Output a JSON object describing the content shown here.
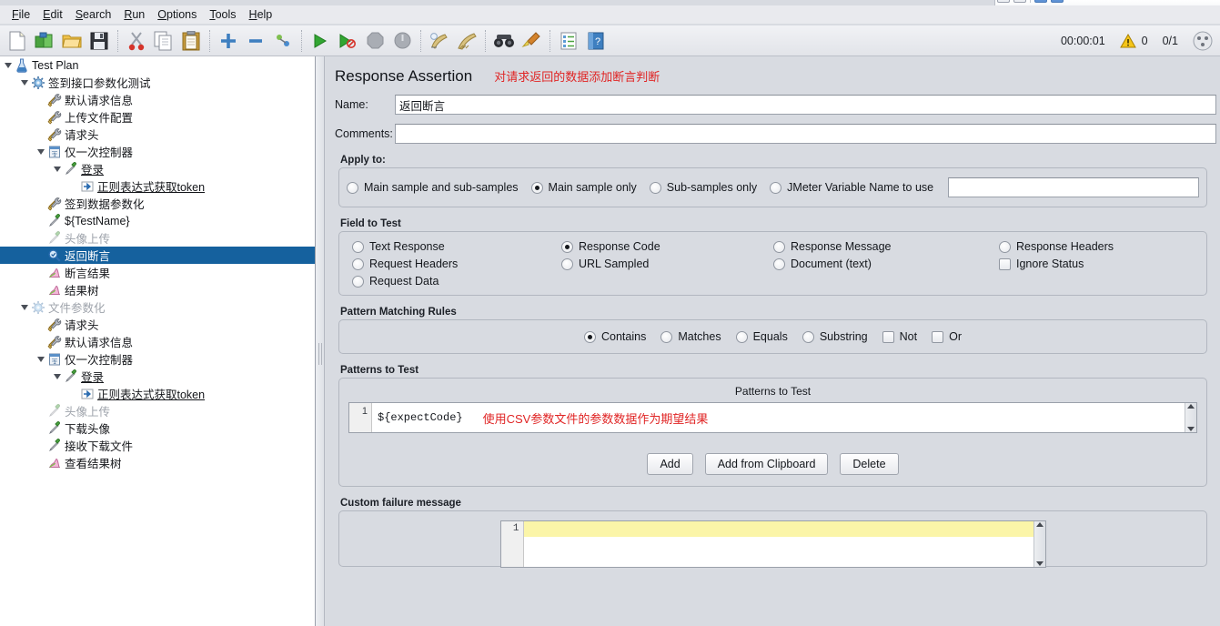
{
  "app": {
    "menus": [
      {
        "label": "File",
        "mnemonic": "F"
      },
      {
        "label": "Edit",
        "mnemonic": "E"
      },
      {
        "label": "Search",
        "mnemonic": "S"
      },
      {
        "label": "Run",
        "mnemonic": "R"
      },
      {
        "label": "Options",
        "mnemonic": "O"
      },
      {
        "label": "Tools",
        "mnemonic": "T"
      },
      {
        "label": "Help",
        "mnemonic": "H"
      }
    ],
    "toolbar": {
      "icons": [
        "new-file-icon",
        "templates-icon",
        "open-icon",
        "save-icon",
        "cut-icon",
        "copy-icon",
        "paste-icon",
        "expand-all-icon",
        "collapse-all-icon",
        "toggle-icon",
        "start-icon",
        "start-no-pauses-icon",
        "stop-icon",
        "shutdown-icon",
        "clear-icon",
        "clear-all-icon",
        "search-icon",
        "search-reset-icon",
        "function-helper-icon",
        "help-icon"
      ],
      "status": {
        "elapsed": "00:00:01",
        "warning_icon": "warning-triangle-icon",
        "warning_count": "0",
        "threads": "0/1",
        "threads_icon": "threads-icon"
      }
    }
  },
  "tree": {
    "nodes": [
      {
        "label": "Test Plan",
        "depth": 0,
        "icon": "test-plan-icon",
        "toggle": "open",
        "selected": false,
        "disabled": false,
        "underline": false
      },
      {
        "label": "签到接口参数化测试",
        "depth": 1,
        "icon": "thread-group-icon",
        "toggle": "open",
        "selected": false,
        "disabled": false,
        "underline": false
      },
      {
        "label": "默认请求信息",
        "depth": 2,
        "icon": "config-element-icon",
        "toggle": "none",
        "selected": false,
        "disabled": false,
        "underline": false
      },
      {
        "label": "上传文件配置",
        "depth": 2,
        "icon": "config-element-icon",
        "toggle": "none",
        "selected": false,
        "disabled": false,
        "underline": false
      },
      {
        "label": "请求头",
        "depth": 2,
        "icon": "config-element-icon",
        "toggle": "none",
        "selected": false,
        "disabled": false,
        "underline": false
      },
      {
        "label": "仅一次控制器",
        "depth": 2,
        "icon": "controller-icon",
        "toggle": "open",
        "selected": false,
        "disabled": false,
        "underline": false
      },
      {
        "label": "登录",
        "depth": 3,
        "icon": "http-sampler-icon",
        "toggle": "open",
        "selected": false,
        "disabled": false,
        "underline": true
      },
      {
        "label": "正则表达式获取token",
        "depth": 4,
        "icon": "post-processor-icon",
        "toggle": "none",
        "selected": false,
        "disabled": false,
        "underline": true
      },
      {
        "label": "签到数据参数化",
        "depth": 2,
        "icon": "config-element-icon",
        "toggle": "none",
        "selected": false,
        "disabled": false,
        "underline": false
      },
      {
        "label": "${TestName}",
        "depth": 2,
        "icon": "http-sampler-icon",
        "toggle": "none",
        "selected": false,
        "disabled": false,
        "underline": false
      },
      {
        "label": "头像上传",
        "depth": 2,
        "icon": "http-sampler-disabled-icon",
        "toggle": "none",
        "selected": false,
        "disabled": true,
        "underline": false
      },
      {
        "label": "返回断言",
        "depth": 2,
        "icon": "assertion-icon",
        "toggle": "none",
        "selected": true,
        "disabled": false,
        "underline": false
      },
      {
        "label": "断言结果",
        "depth": 2,
        "icon": "listener-icon",
        "toggle": "none",
        "selected": false,
        "disabled": false,
        "underline": false
      },
      {
        "label": "结果树",
        "depth": 2,
        "icon": "listener-icon",
        "toggle": "none",
        "selected": false,
        "disabled": false,
        "underline": false
      },
      {
        "label": "文件参数化",
        "depth": 1,
        "icon": "thread-group-disabled-icon",
        "toggle": "open",
        "selected": false,
        "disabled": true,
        "underline": false
      },
      {
        "label": "请求头",
        "depth": 2,
        "icon": "config-element-icon",
        "toggle": "none",
        "selected": false,
        "disabled": false,
        "underline": false
      },
      {
        "label": "默认请求信息",
        "depth": 2,
        "icon": "config-element-icon",
        "toggle": "none",
        "selected": false,
        "disabled": false,
        "underline": false
      },
      {
        "label": "仅一次控制器",
        "depth": 2,
        "icon": "controller-icon",
        "toggle": "open",
        "selected": false,
        "disabled": false,
        "underline": false
      },
      {
        "label": "登录",
        "depth": 3,
        "icon": "http-sampler-icon",
        "toggle": "open",
        "selected": false,
        "disabled": false,
        "underline": true
      },
      {
        "label": "正则表达式获取token",
        "depth": 4,
        "icon": "post-processor-icon",
        "toggle": "none",
        "selected": false,
        "disabled": false,
        "underline": true
      },
      {
        "label": "头像上传",
        "depth": 2,
        "icon": "http-sampler-disabled-icon",
        "toggle": "none",
        "selected": false,
        "disabled": true,
        "underline": false
      },
      {
        "label": "下载头像",
        "depth": 2,
        "icon": "http-sampler-icon",
        "toggle": "none",
        "selected": false,
        "disabled": false,
        "underline": false
      },
      {
        "label": "接收下载文件",
        "depth": 2,
        "icon": "http-sampler-icon",
        "toggle": "none",
        "selected": false,
        "disabled": false,
        "underline": false
      },
      {
        "label": "查看结果树",
        "depth": 2,
        "icon": "listener-icon",
        "toggle": "none",
        "selected": false,
        "disabled": false,
        "underline": false
      }
    ]
  },
  "panel": {
    "title": "Response Assertion",
    "title_note": "对请求返回的数据添加断言判断",
    "name_label": "Name:",
    "name_value": "返回断言",
    "comments_label": "Comments:",
    "comments_value": "",
    "apply_to": {
      "title": "Apply to:",
      "options": [
        {
          "label": "Main sample and sub-samples",
          "selected": false
        },
        {
          "label": "Main sample only",
          "selected": true
        },
        {
          "label": "Sub-samples only",
          "selected": false
        },
        {
          "label": "JMeter Variable Name to use",
          "selected": false
        }
      ],
      "variable_value": ""
    },
    "field_to_test": {
      "title": "Field to Test",
      "col1": [
        {
          "label": "Text Response",
          "type": "radio",
          "selected": false
        },
        {
          "label": "Request Headers",
          "type": "radio",
          "selected": false
        },
        {
          "label": "Request Data",
          "type": "radio",
          "selected": false
        }
      ],
      "col2": [
        {
          "label": "Response Code",
          "type": "radio",
          "selected": true
        },
        {
          "label": "URL Sampled",
          "type": "radio",
          "selected": false
        }
      ],
      "col3": [
        {
          "label": "Response Message",
          "type": "radio",
          "selected": false
        },
        {
          "label": "Document (text)",
          "type": "radio",
          "selected": false
        }
      ],
      "col4": [
        {
          "label": "Response Headers",
          "type": "radio",
          "selected": false
        },
        {
          "label": "Ignore Status",
          "type": "checkbox",
          "selected": false
        }
      ]
    },
    "pattern_matching_rules": {
      "title": "Pattern Matching Rules",
      "options": [
        {
          "label": "Contains",
          "type": "radio",
          "selected": true
        },
        {
          "label": "Matches",
          "type": "radio",
          "selected": false
        },
        {
          "label": "Equals",
          "type": "radio",
          "selected": false
        },
        {
          "label": "Substring",
          "type": "radio",
          "selected": false
        },
        {
          "label": "Not",
          "type": "checkbox",
          "selected": false
        },
        {
          "label": "Or",
          "type": "checkbox",
          "selected": false
        }
      ]
    },
    "patterns_to_test": {
      "title": "Patterns to Test",
      "column_header": "Patterns to Test",
      "rows": [
        {
          "num": "1",
          "value": "${expectCode}",
          "note": "使用CSV参数文件的参数数据作为期望结果"
        }
      ],
      "buttons": [
        {
          "label": "Add",
          "name": "add-button"
        },
        {
          "label": "Add from Clipboard",
          "name": "add-from-clipboard-button"
        },
        {
          "label": "Delete",
          "name": "delete-button"
        }
      ]
    },
    "custom_failure_message": {
      "title": "Custom failure message",
      "rows": [
        {
          "num": "1",
          "value": ""
        }
      ]
    }
  },
  "colors": {
    "selection": "#15619e",
    "note_red": "#e02424",
    "panel_bg": "#d8dbe1",
    "highlight_line": "#fbf5a8"
  }
}
